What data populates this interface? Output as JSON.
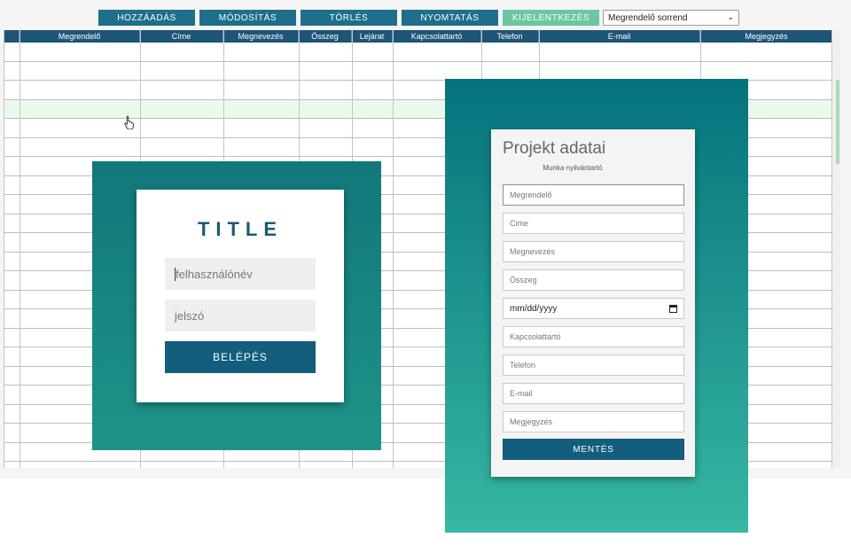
{
  "toolbar": {
    "buttons": [
      {
        "label": "HOZZÁADÁS"
      },
      {
        "label": "MÓDOSÍTÁS"
      },
      {
        "label": "TÖRLÉS"
      },
      {
        "label": "NYOMTATÁS"
      },
      {
        "label": "KIJELENTKEZÉS"
      }
    ],
    "sort_select": "Megrendelő sorrend"
  },
  "table": {
    "columns": [
      "Megrendelő",
      "Címe",
      "Megnevezés",
      "Összeg",
      "Lejárat",
      "Kapcsolattartó",
      "Telefon",
      "E-mail",
      "Megjegyzés"
    ],
    "highlighted_row": 3
  },
  "login": {
    "title": "TITLE",
    "username_placeholder": "felhasználónév",
    "password_placeholder": "jelszó",
    "submit_label": "BELÉPÉS"
  },
  "project": {
    "title": "Projekt adatai",
    "subtitle": "Munka nyilvántartó",
    "fields": {
      "megrendelo": "Megrendelő",
      "cime": "Cime",
      "megnevezes": "Megnevezés",
      "osszeg": "Összeg",
      "lejarat": "mm/dd/yyyy",
      "kapcsolattarto": "Kapcsolattartó",
      "telefon": "Telefon",
      "email": "E-mail",
      "megjegyzes": "Megjegyzés"
    },
    "save_label": "MENTÉS"
  },
  "colors": {
    "header_navy": "#1d5577",
    "button_teal": "#1e6f8c",
    "button_active_green": "#6cc7a1",
    "panel_teal": "#127779",
    "row_highlight": "#eafaea"
  }
}
